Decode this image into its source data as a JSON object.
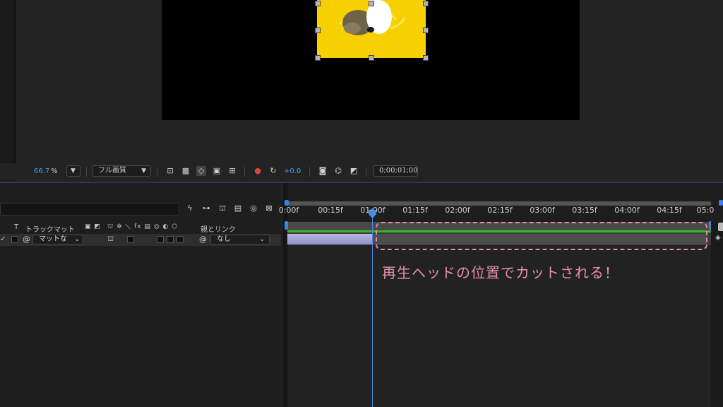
{
  "viewer": {
    "zoom_value": "66.7",
    "zoom_unit": "%",
    "resolution": "フル画質",
    "exposure": "+0.0",
    "timecode": "0;00;01;00"
  },
  "timeline": {
    "header": {
      "t_label": "T",
      "track_matte": "トラックマット",
      "parent_link": "親とリンク"
    },
    "layer": {
      "matte_value": "マットな",
      "parent_value": "なし"
    },
    "ruler_ticks": [
      "0:00f",
      "00:15f",
      "01:00f",
      "01:15f",
      "02:00f",
      "02:15f",
      "03:00f",
      "03:15f",
      "04:00f",
      "04:15f",
      "05:0"
    ]
  },
  "annotation": "再生ヘッドの位置でカットされる！",
  "colors": {
    "accent_blue": "#4b8be8",
    "clip_lavender": "#a7a9dc",
    "work_area_green": "#38b62c",
    "annotation_pink": "#e890a6",
    "artwork_yellow": "#f6d000"
  },
  "icons": [
    "lightning-icon",
    "graph-editor-icon",
    "shy-icon",
    "frame-blend-icon",
    "motion-blur-icon",
    "comp-flowchart-icon",
    "camera-icon",
    "channel-icon",
    "reset-exposure-icon",
    "spiral-icon"
  ]
}
